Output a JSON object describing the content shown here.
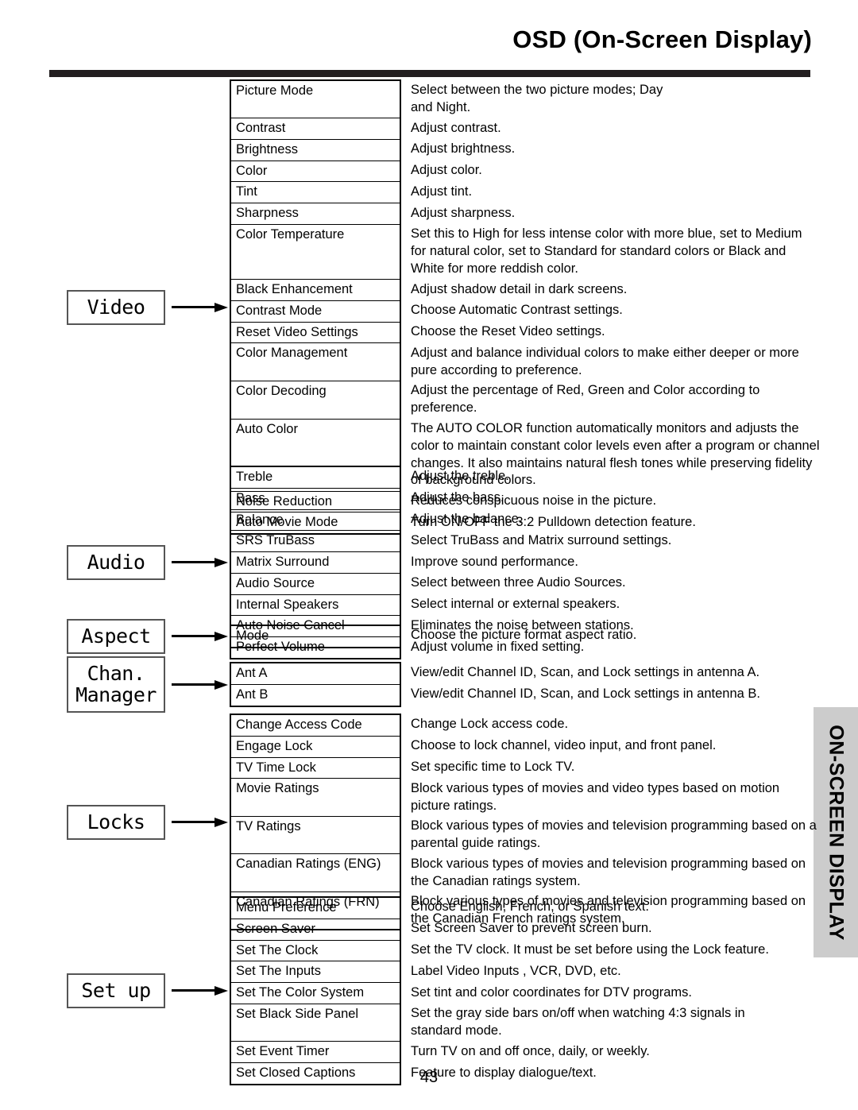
{
  "header": {
    "title": "OSD (On-Screen Display)"
  },
  "side_tab": {
    "label": "ON-SCREEN DISPLAY"
  },
  "page_number": "43",
  "groups": [
    {
      "id": "video",
      "category_lines": [
        "Video"
      ],
      "rows": [
        {
          "item": "Picture Mode",
          "desc": [
            "Select between the two picture modes; Day",
            "and Night."
          ]
        },
        {
          "item": "Contrast",
          "desc": [
            "Adjust contrast."
          ]
        },
        {
          "item": "Brightness",
          "desc": [
            "Adjust brightness."
          ]
        },
        {
          "item": "Color",
          "desc": [
            "Adjust color."
          ]
        },
        {
          "item": "Tint",
          "desc": [
            "Adjust tint."
          ]
        },
        {
          "item": "Sharpness",
          "desc": [
            "Adjust sharpness."
          ]
        },
        {
          "item": "Color Temperature",
          "desc": [
            "Set this to High for less intense color with more blue, set to Medium",
            "for natural color, set to Standard for standard colors or Black and",
            "White for more reddish color."
          ]
        },
        {
          "item": "Black Enhancement",
          "desc": [
            "Adjust shadow detail in dark screens."
          ]
        },
        {
          "item": "Contrast Mode",
          "desc": [
            "Choose Automatic Contrast settings."
          ]
        },
        {
          "item": "Reset Video Settings",
          "desc": [
            "Choose the Reset Video settings."
          ]
        },
        {
          "item": "Color Management",
          "desc": [
            "Adjust and balance individual colors to make either deeper or more",
            "pure according to preference."
          ]
        },
        {
          "item": "Color Decoding",
          "desc": [
            "Adjust the percentage of Red, Green and Color according to",
            "preference."
          ]
        },
        {
          "item": "Auto Color",
          "desc": [
            "The AUTO COLOR function automatically monitors and adjusts the",
            "color to maintain constant color levels even after a program or channel",
            "changes. It also maintains natural flesh tones while preserving fidelity",
            "of background colors."
          ]
        },
        {
          "item": "Noise Reduction",
          "desc": [
            "Reduces conspicuous noise in the picture."
          ]
        },
        {
          "item": "Auto Movie Mode",
          "desc": [
            "Turn ON/OFF the 3:2 Pulldown detection feature."
          ]
        }
      ]
    },
    {
      "id": "audio",
      "category_lines": [
        "Audio"
      ],
      "rows": [
        {
          "item": "Treble",
          "desc": [
            "Adjust the treble."
          ]
        },
        {
          "item": "Bass",
          "desc": [
            "Adjust the bass."
          ]
        },
        {
          "item": "Balance",
          "desc": [
            "Adjust the balance."
          ]
        },
        {
          "item": "SRS TruBass",
          "desc": [
            "Select TruBass and Matrix surround settings."
          ]
        },
        {
          "item": "Matrix Surround",
          "desc": [
            "Improve sound performance."
          ]
        },
        {
          "item": "Audio Source",
          "desc": [
            "Select between three Audio Sources."
          ]
        },
        {
          "item": "Internal Speakers",
          "desc": [
            "Select internal or external speakers."
          ]
        },
        {
          "item": "Auto Noise Cancel",
          "desc": [
            "Eliminates the noise between stations."
          ]
        },
        {
          "item": "Perfect Volume",
          "desc": [
            "Adjust volume in fixed setting."
          ]
        }
      ]
    },
    {
      "id": "aspect",
      "category_lines": [
        "Aspect"
      ],
      "rows": [
        {
          "item": "Mode",
          "desc": [
            "Choose the picture format aspect ratio."
          ]
        }
      ]
    },
    {
      "id": "chan-manager",
      "category_lines": [
        "Chan.",
        "Manager"
      ],
      "rows": [
        {
          "item": "Ant A",
          "desc": [
            "View/edit Channel ID, Scan, and Lock settings in antenna A."
          ]
        },
        {
          "item": "Ant B",
          "desc": [
            "View/edit Channel ID, Scan, and Lock settings in antenna B."
          ]
        }
      ]
    },
    {
      "id": "locks",
      "category_lines": [
        "Locks"
      ],
      "rows": [
        {
          "item": "Change Access Code",
          "desc": [
            "Change Lock access code."
          ]
        },
        {
          "item": "Engage Lock",
          "desc": [
            "Choose to lock channel, video input, and front panel."
          ]
        },
        {
          "item": "TV Time Lock",
          "desc": [
            "Set specific time to Lock TV."
          ]
        },
        {
          "item": "Movie Ratings",
          "desc": [
            "Block various types of movies and video types based on motion",
            "picture ratings."
          ]
        },
        {
          "item": "TV Ratings",
          "desc": [
            "Block various types of movies and television programming based on a",
            "parental guide ratings."
          ]
        },
        {
          "item": "Canadian Ratings (ENG)",
          "desc": [
            "Block various types of movies and television programming based on",
            "the Canadian ratings system."
          ]
        },
        {
          "item": "Canadian Ratings (FRN)",
          "desc": [
            "Block various types of movies and television programming based on",
            "the Canadian French ratings system."
          ]
        }
      ]
    },
    {
      "id": "setup",
      "category_lines": [
        "Set up"
      ],
      "rows": [
        {
          "item": "Menu Preference",
          "desc": [
            "Choose English, French, or Spanish text."
          ]
        },
        {
          "item": "Screen Saver",
          "desc": [
            "Set Screen Saver to prevent screen burn."
          ]
        },
        {
          "item": "Set The Clock",
          "desc": [
            "Set the TV clock.  It must be set before using the Lock feature."
          ]
        },
        {
          "item": "Set The Inputs",
          "desc": [
            "Label Video Inputs , VCR, DVD, etc."
          ]
        },
        {
          "item": "Set The Color System",
          "desc": [
            "Set tint and color coordinates for DTV programs."
          ]
        },
        {
          "item": "Set Black Side Panel",
          "desc": [
            "Set the gray side bars on/off when watching 4:3 signals in",
            "standard mode."
          ]
        },
        {
          "item": "Set Event Timer",
          "desc": [
            "Turn TV on and off once, daily, or weekly."
          ]
        },
        {
          "item": "Set Closed Captions",
          "desc": [
            "Feature to display dialogue/text."
          ]
        }
      ]
    }
  ]
}
